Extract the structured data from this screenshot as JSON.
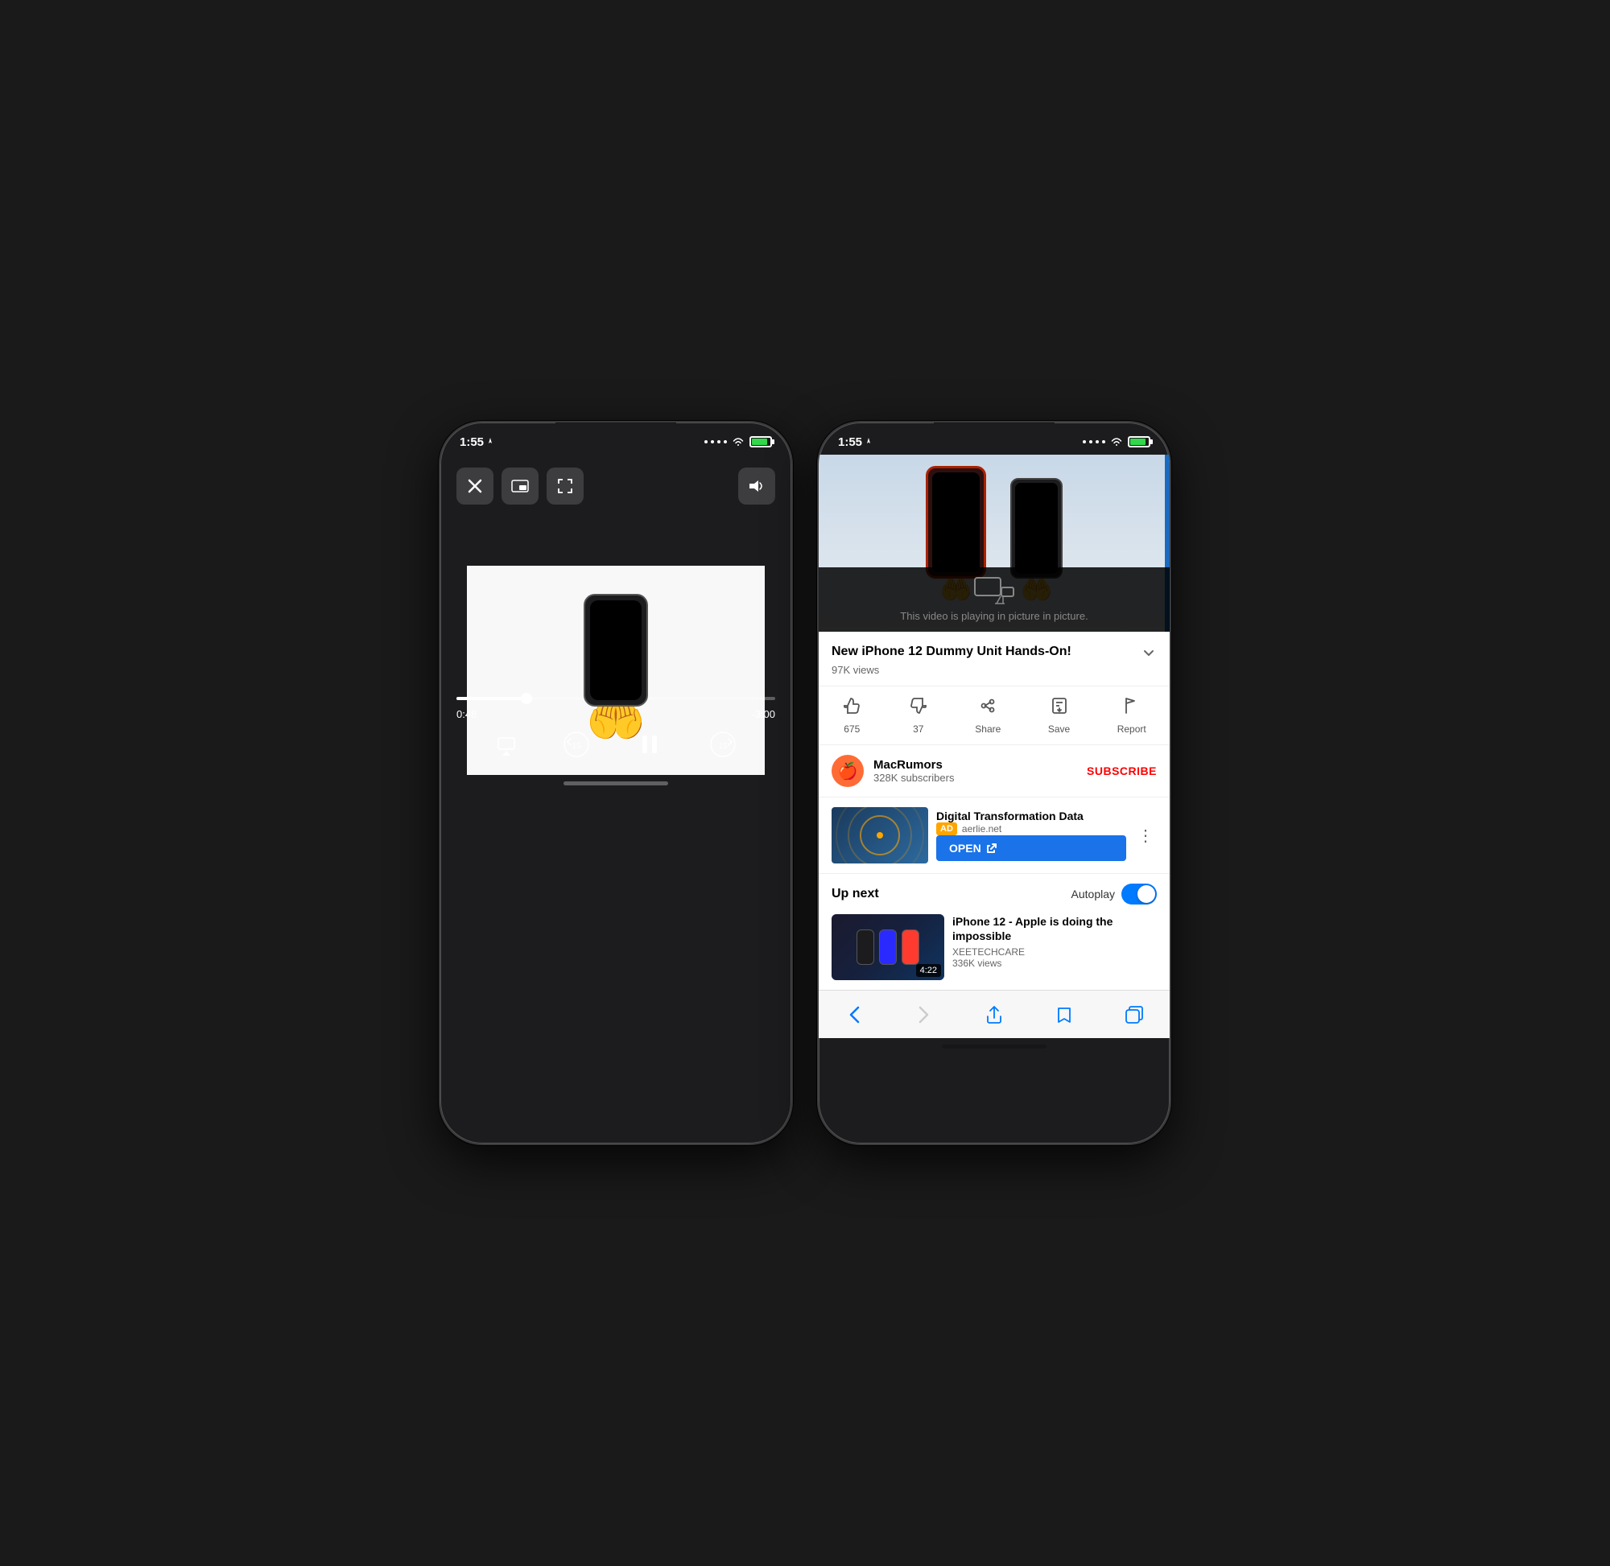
{
  "phone1": {
    "status": {
      "time": "1:55",
      "location_icon": true,
      "dots": "····",
      "wifi": true,
      "battery_pct": 80
    },
    "controls": {
      "close_label": "✕",
      "pip_label": "⬛",
      "expand_label": "⬜",
      "volume_label": "🔊"
    },
    "video": {
      "current_time": "0:48",
      "remaining_time": "-3:00",
      "progress_pct": 22
    },
    "playback": {
      "airplay_label": "⬛",
      "rewind_label": "15",
      "pause_label": "⏸",
      "forward_label": "15"
    }
  },
  "phone2": {
    "status": {
      "time": "1:55",
      "location_icon": true,
      "dots": "····",
      "wifi": true,
      "battery_pct": 80
    },
    "pip": {
      "message": "This video is playing in picture in picture."
    },
    "youtube": {
      "video_title": "New iPhone 12 Dummy Unit Hands-On!",
      "views": "97K views",
      "likes": "675",
      "dislikes": "37",
      "share_label": "Share",
      "save_label": "Save",
      "report_label": "Report",
      "channel_name": "MacRumors",
      "channel_subs": "328K subscribers",
      "subscribe_label": "SUBSCRIBE"
    },
    "ad": {
      "title": "Digital Transformation Data",
      "badge": "AD",
      "domain": "aerlie.net",
      "open_label": "OPEN"
    },
    "up_next": {
      "label": "Up next",
      "autoplay_label": "Autoplay",
      "next_video_title": "iPhone 12 - Apple is doing the impossible",
      "next_video_channel": "XEETECHCARE",
      "next_video_views": "336K views",
      "next_video_duration": "4:22"
    },
    "safari_nav": {
      "back_label": "‹",
      "forward_label": "›",
      "share_label": "↑",
      "bookmarks_label": "📖",
      "tabs_label": "⧉"
    }
  }
}
